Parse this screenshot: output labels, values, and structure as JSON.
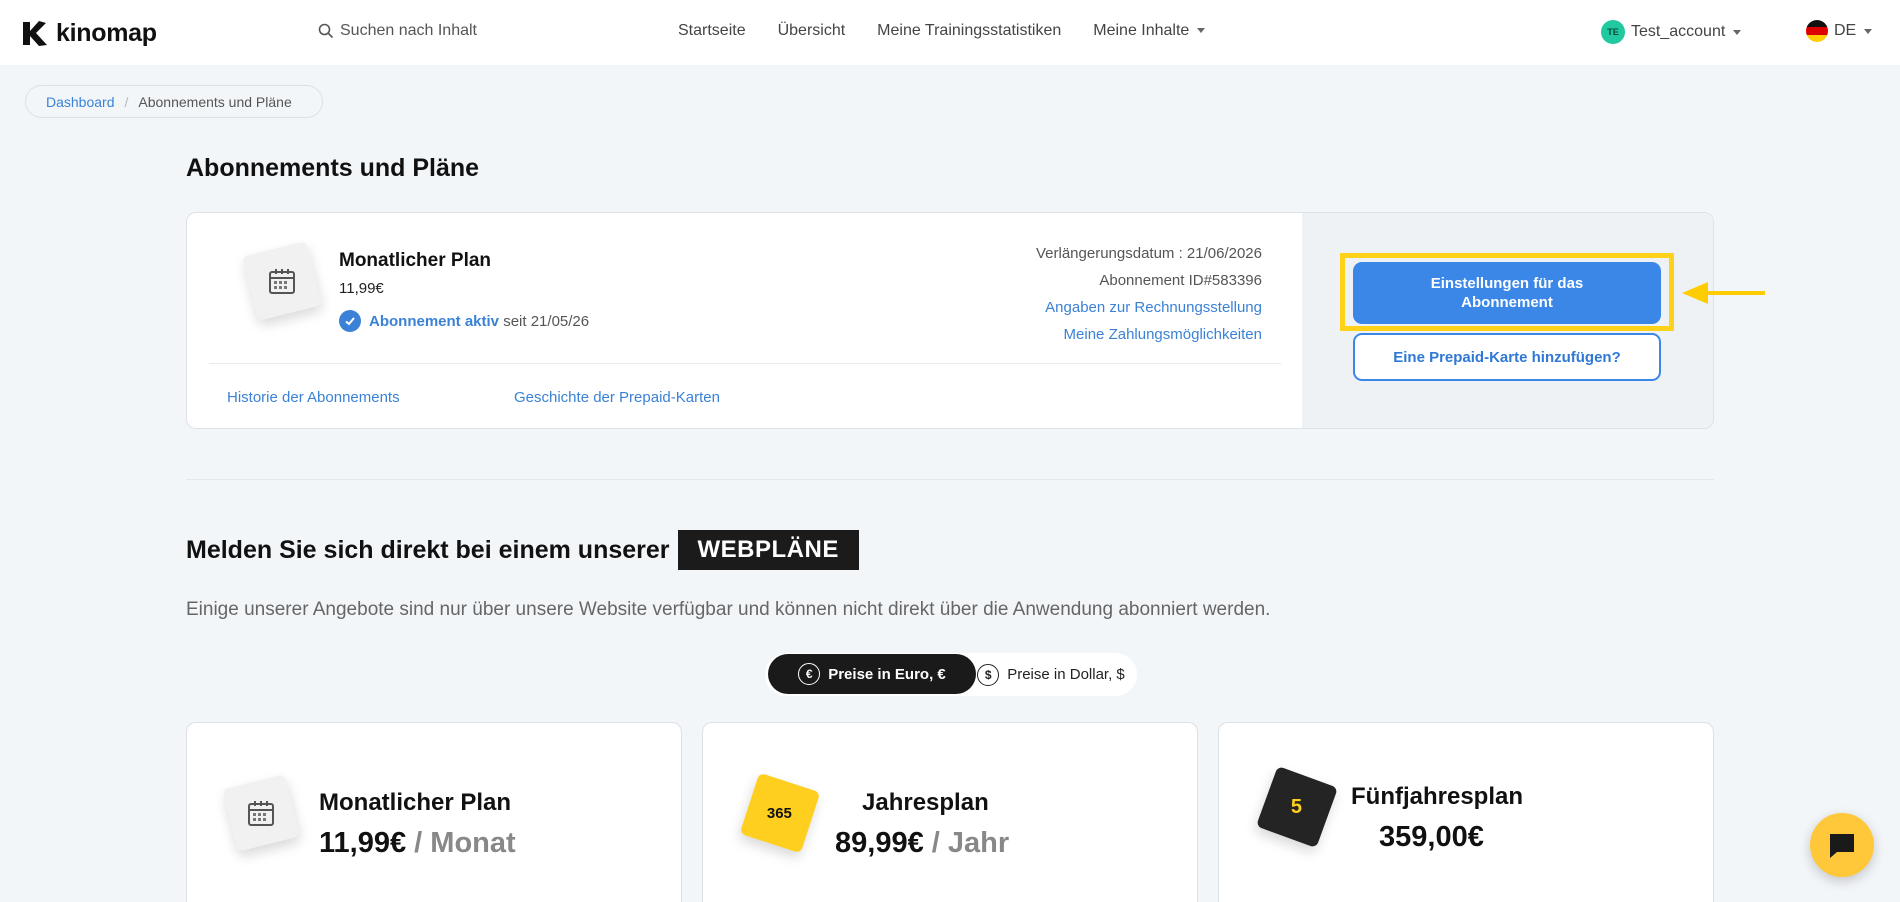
{
  "brand": {
    "name": "kinomap"
  },
  "nav": {
    "search_placeholder": "Suchen nach Inhalt",
    "links": [
      "Startseite",
      "Übersicht",
      "Meine Trainingsstatistiken",
      "Meine Inhalte"
    ],
    "account_initials": "TE",
    "account_name": "Test_account",
    "language": "DE"
  },
  "breadcrumb": {
    "home": "Dashboard",
    "current": "Abonnements und Pläne"
  },
  "page": {
    "title": "Abonnements und Pläne"
  },
  "subscription": {
    "plan_name": "Monatlicher Plan",
    "price": "11,99€",
    "status_active": "Abonnement aktiv",
    "status_since": "seit 21/05/26",
    "renewal": "Verlängerungsdatum : 21/06/2026",
    "subscription_id": "Abonnement ID#583396",
    "billing_link": "Angaben zur Rechnungsstellung",
    "payment_link": "Meine Zahlungsmöglichkeiten",
    "history_link": "Historie der Abonnements",
    "prepaid_history_link": "Geschichte der Prepaid-Karten",
    "settings_button": "Einstellungen für das Abonnement",
    "prepaid_button": "Eine Prepaid-Karte hinzufügen?"
  },
  "webplans": {
    "title": "Melden Sie sich direkt bei einem unserer",
    "badge": "WEBPLÄNE",
    "description": "Einige unserer Angebote sind nur über unsere Website verfügbar und können nicht direkt über die Anwendung abonniert werden.",
    "currency_euro": "Preise in Euro, €",
    "currency_dollar": "Preise in Dollar, $",
    "euro_symbol": "€",
    "dollar_symbol": "$",
    "plans": [
      {
        "name": "Monatlicher Plan",
        "price": "11,99€",
        "period": "/ Monat"
      },
      {
        "name": "Jahresplan",
        "price": "89,99€",
        "period": "/ Jahr",
        "icon_label": "365"
      },
      {
        "name": "Fünfjahresplan",
        "price": "359,00€",
        "period": "",
        "icon_label": "5"
      }
    ]
  },
  "colors": {
    "accent": "#3a87e8",
    "highlight": "#ffd21a",
    "chat": "#ffc83a"
  }
}
